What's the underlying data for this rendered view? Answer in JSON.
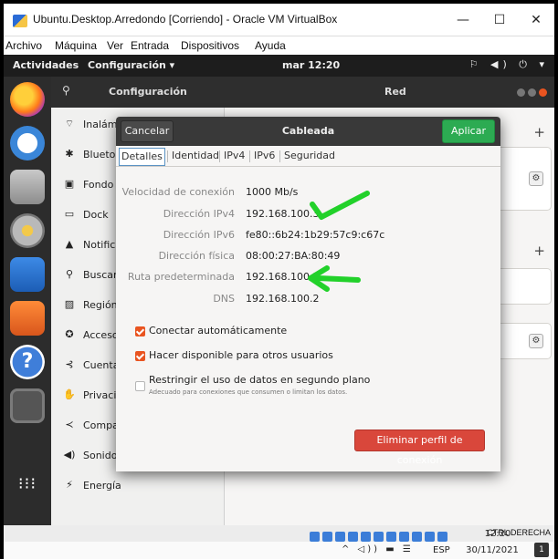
{
  "window": {
    "title": "Ubuntu.Desktop.Arredondo [Corriendo] - Oracle VM VirtualBox",
    "minimize_glyph": "—",
    "maximize_glyph": "☐",
    "close_glyph": "✕"
  },
  "vbox_menu": [
    "Archivo",
    "Máquina",
    "Ver",
    "Entrada",
    "Dispositivos",
    "Ayuda"
  ],
  "topbar": {
    "activities": "Actividades",
    "app_menu": "Configuración ▾",
    "clock": "mar 12:20",
    "tray": "⚐ ◀) ⏻ ▾"
  },
  "settings": {
    "sidebar_title": "Configuración",
    "panel_title": "Red",
    "sidebar_items": [
      {
        "icon": "wifi-icon",
        "glyph": "⌔",
        "label": "Inalámbrica"
      },
      {
        "icon": "bluetooth-icon",
        "glyph": "✱",
        "label": "Bluetooth"
      },
      {
        "icon": "background-icon",
        "glyph": "▣",
        "label": "Fondo"
      },
      {
        "icon": "dock-icon",
        "glyph": "▭",
        "label": "Dock"
      },
      {
        "icon": "notifications-icon",
        "glyph": "▲",
        "label": "Notificaciones"
      },
      {
        "icon": "search-icon",
        "glyph": "⚲",
        "label": "Buscar"
      },
      {
        "icon": "region-icon",
        "glyph": "▨",
        "label": "Región"
      },
      {
        "icon": "accessibility-icon",
        "glyph": "✪",
        "label": "Acceso universal"
      },
      {
        "icon": "accounts-icon",
        "glyph": "⊰",
        "label": "Cuentas"
      },
      {
        "icon": "privacy-icon",
        "glyph": "✋",
        "label": "Privacidad"
      },
      {
        "icon": "sharing-icon",
        "glyph": "≺",
        "label": "Compartir"
      },
      {
        "icon": "sound-icon",
        "glyph": "◀)",
        "label": "Sonido"
      },
      {
        "icon": "power-icon",
        "glyph": "⚡",
        "label": "Energía"
      }
    ]
  },
  "dialog": {
    "cancel": "Cancelar",
    "title": "Cableada",
    "apply": "Aplicar",
    "tabs": [
      "Detalles",
      "Identidad",
      "IPv4",
      "IPv6",
      "Seguridad"
    ],
    "details": [
      {
        "key": "Velocidad de conexión",
        "value": "1000 Mb/s"
      },
      {
        "key": "Dirección IPv4",
        "value": "192.168.100.3"
      },
      {
        "key": "Dirección IPv6",
        "value": "fe80::6b24:1b29:57c9:c67c"
      },
      {
        "key": "Dirección física",
        "value": "08:00:27:BA:80:49"
      },
      {
        "key": "Ruta predeterminada",
        "value": "192.168.100.2"
      },
      {
        "key": "DNS",
        "value": "192.168.100.2"
      }
    ],
    "checks": [
      {
        "label": "Conectar automáticamente",
        "checked": true
      },
      {
        "label": "Hacer disponible para otros usuarios",
        "checked": true
      },
      {
        "label": "Restringir el uso de datos en segundo plano",
        "sublabel": "Adecuado para conexiones que consumen o limitan los datos.",
        "checked": false
      }
    ],
    "delete_button": "Eliminar perfil de conexión"
  },
  "statusbar": {
    "host_key": "CTRL DERECHA"
  },
  "taskbar": {
    "tray_icons": "^ ◁)) ▬ ☰",
    "language": "ESP",
    "time": "12:20",
    "date": "30/11/2021",
    "notifications_count": "1"
  },
  "colors": {
    "accent": "#e95420",
    "apply_green": "#2cab52",
    "delete_red": "#d9473b",
    "annotation_green": "#22d12a"
  }
}
